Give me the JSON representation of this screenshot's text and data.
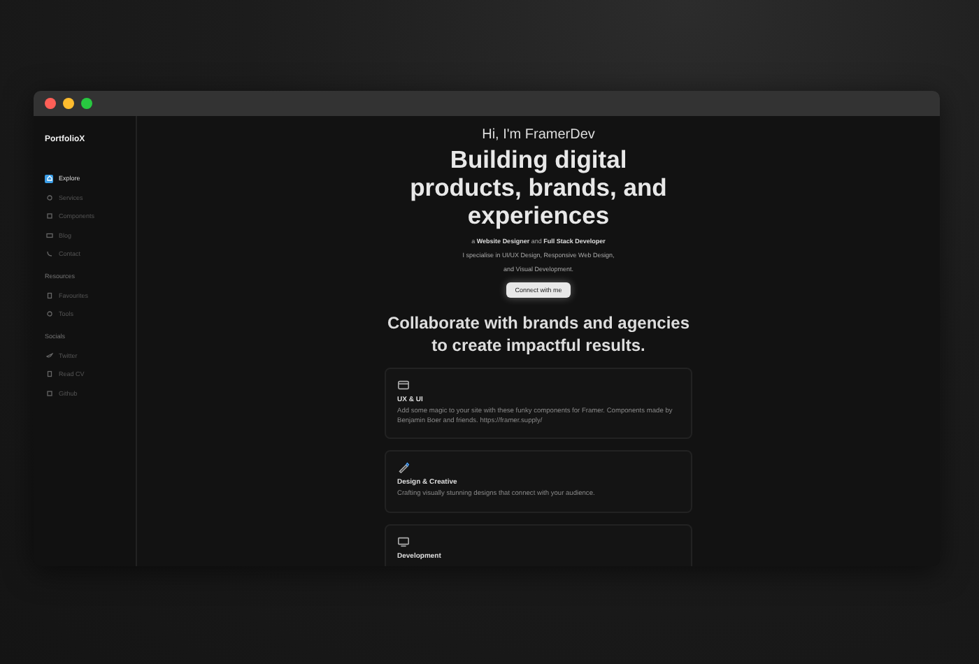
{
  "sidebar": {
    "brand": "PortfolioX",
    "sections": [
      {
        "items": [
          {
            "label": "Explore",
            "selected": true
          },
          {
            "label": "Services",
            "selected": false
          },
          {
            "label": "Components",
            "selected": false
          },
          {
            "label": "Blog",
            "selected": false
          },
          {
            "label": "Contact",
            "selected": false
          }
        ]
      },
      {
        "title": "Resources",
        "items": [
          {
            "label": "Favourites",
            "selected": false
          },
          {
            "label": "Tools",
            "selected": false
          }
        ]
      },
      {
        "title": "Socials",
        "items": [
          {
            "label": "Twitter",
            "selected": false
          },
          {
            "label": "Read CV",
            "selected": false
          },
          {
            "label": "Github",
            "selected": false
          }
        ]
      }
    ]
  },
  "hero": {
    "greeting": "Hi, I'm FramerDev",
    "headline": "Building digital products, brands, and experiences",
    "intro": "a **Website Designer** and **Full Stack Developer**",
    "lines": [
      "I specialise in UI/UX Design, Responsive Web Design,",
      "and Visual Development."
    ],
    "button": "Connect with me"
  },
  "section_title": "Collaborate with brands and agencies to create impactful results.",
  "cards": [
    {
      "title": "UX & UI",
      "text": "Add some magic to your site with these funky components for Framer. Components made by Benjamin Boer and friends. https://framer.supply/"
    },
    {
      "title": "Design & Creative",
      "text": "Crafting visually stunning designs that connect with your audience."
    },
    {
      "title": "Development"
    }
  ]
}
